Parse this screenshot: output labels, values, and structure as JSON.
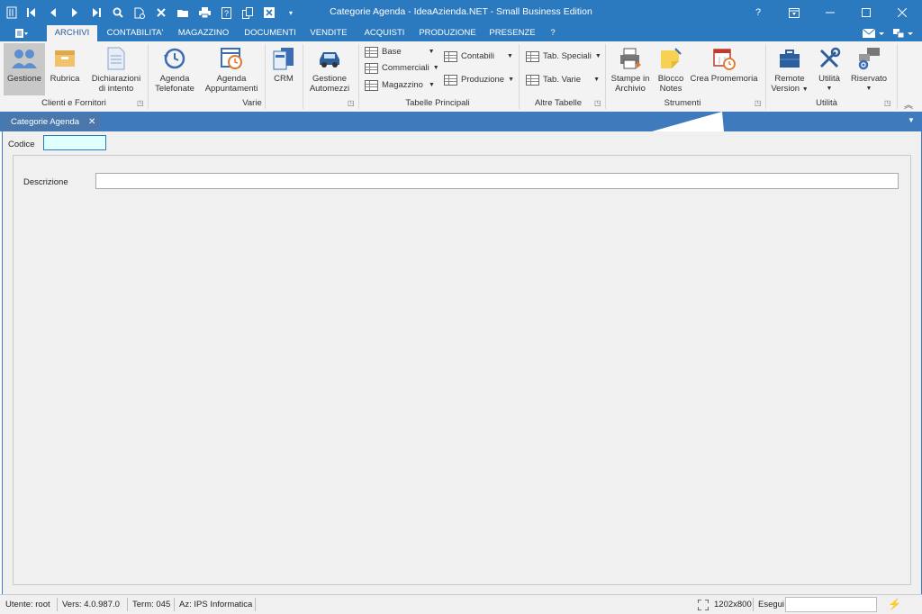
{
  "window": {
    "title": "Categorie Agenda - IdeaAzienda.NET - Small Business Edition",
    "help": "?"
  },
  "ribbon_tabs": [
    "ARCHIVI",
    "CONTABILITA'",
    "MAGAZZINO",
    "DOCUMENTI",
    "VENDITE",
    "ACQUISTI",
    "PRODUZIONE",
    "PRESENZE",
    "?"
  ],
  "active_tab": "ARCHIVI",
  "ribbon": {
    "clienti": {
      "label": "Clienti e Fornitori",
      "gestione": "Gestione",
      "rubrica": "Rubrica",
      "dichiarazioni_1": "Dichiarazioni",
      "dichiarazioni_2": "di intento"
    },
    "varie": {
      "label": "Varie",
      "telefonate_1": "Agenda",
      "telefonate_2": "Telefonate",
      "appuntamenti_1": "Agenda",
      "appuntamenti_2": "Appuntamenti",
      "crm": "CRM",
      "automezzi_1": "Gestione",
      "automezzi_2": "Automezzi"
    },
    "tabelle": {
      "label": "Tabelle Principali",
      "base": "Base",
      "commerciali": "Commerciali",
      "magazzino": "Magazzino",
      "contabili": "Contabili",
      "produzione": "Produzione"
    },
    "altre": {
      "label": "Altre Tabelle",
      "speciali": "Tab. Speciali",
      "varie": "Tab. Varie"
    },
    "strumenti": {
      "label": "Strumenti",
      "stampe_1": "Stampe in",
      "stampe_2": "Archivio",
      "blocco_1": "Blocco",
      "blocco_2": "Notes",
      "promemoria": "Crea Promemoria"
    },
    "utilita": {
      "label": "Utilità",
      "remote_1": "Remote",
      "remote_2": "Version",
      "utilita": "Utilità",
      "riservato": "Riservato"
    }
  },
  "document_tab": {
    "label": "Categorie Agenda",
    "close": "✕"
  },
  "form": {
    "codice_label": "Codice",
    "codice_value": "",
    "descrizione_label": "Descrizione",
    "descrizione_value": ""
  },
  "status": {
    "utente": "Utente: root",
    "versione": "Vers: 4.0.987.0",
    "terminale": "Term: 045",
    "azienda": "Az: IPS Informatica",
    "resolution": "1202x800",
    "esegui": "Esegui",
    "esegui_value": ""
  },
  "colors": {
    "accent": "#2b79bf",
    "form_bg": "#f0f0f0",
    "input_focus": "#e0ffff",
    "flash": "#f5a623"
  }
}
